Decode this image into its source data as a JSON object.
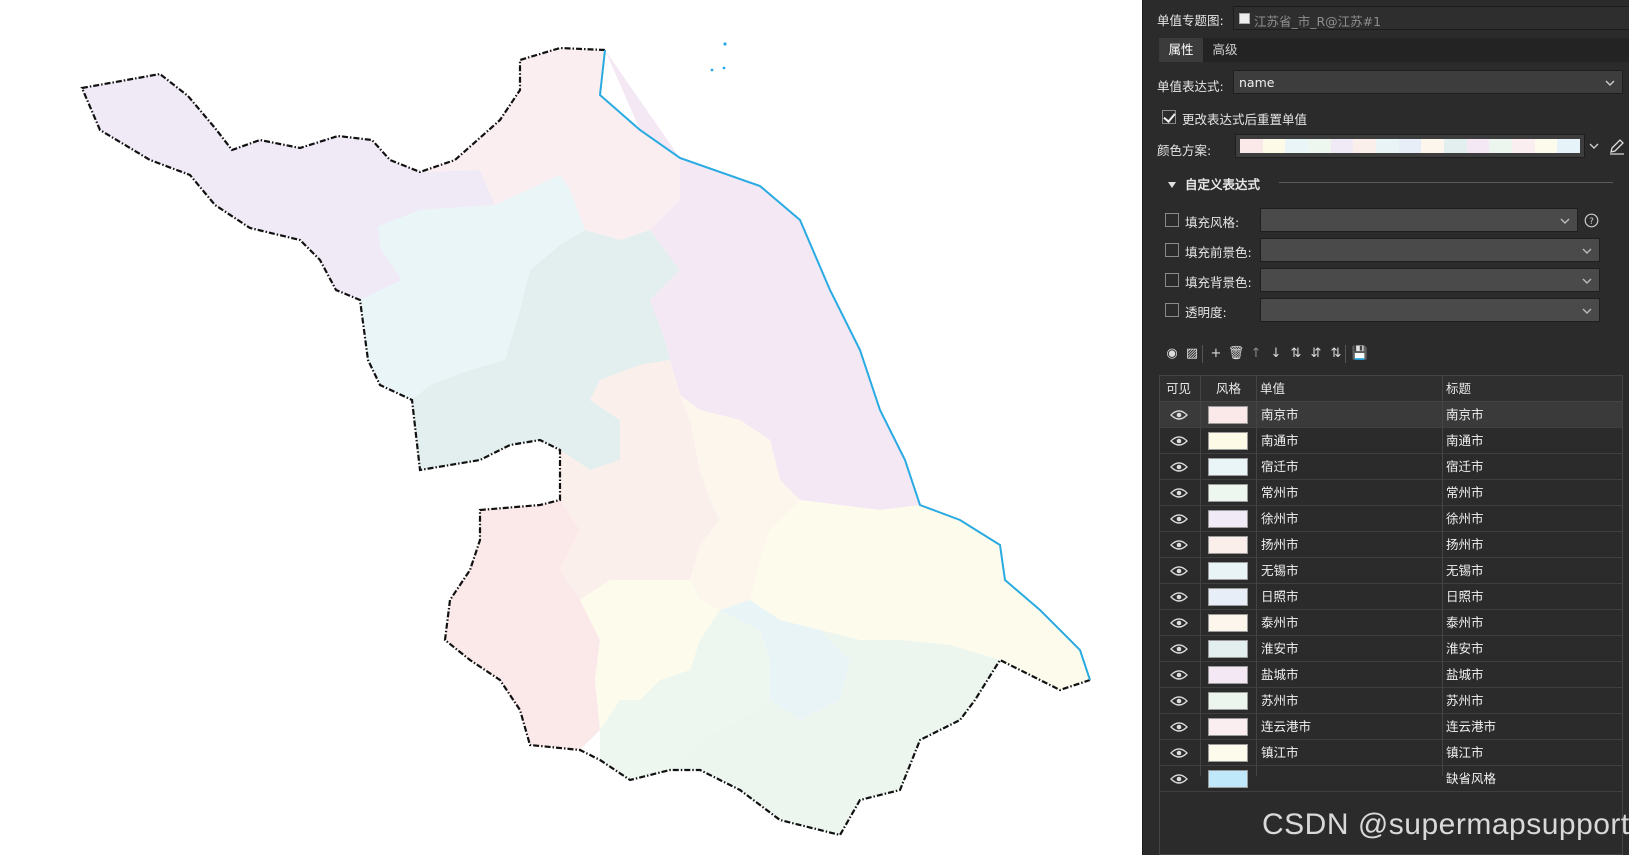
{
  "panel": {
    "thematic_label": "单值专题图:",
    "thematic_value": "江苏省_市_R@江苏#1",
    "tabs": [
      {
        "label": "属性",
        "active": true
      },
      {
        "label": "高级",
        "active": false
      }
    ],
    "expression_label": "单值表达式:",
    "expression_value": "name",
    "reset_checkbox_label": "更改表达式后重置单值",
    "reset_checked": true,
    "color_scheme_label": "颜色方案:",
    "color_scheme": [
      "#fbe9ea",
      "#fdfbe8",
      "#e9f5f7",
      "#eef7ef",
      "#f0e9f6",
      "#fbefec",
      "#e9f4f6",
      "#e8eef8",
      "#fcf6ec",
      "#e2efee",
      "#f4e8f4",
      "#ecf5ee",
      "#faeef0",
      "#fcfbec",
      "#e6f3f8"
    ],
    "custom_expr_section": "自定义表达式",
    "custom_fields": [
      {
        "label": "填充风格:",
        "checked": false,
        "help": true
      },
      {
        "label": "填充前景色:",
        "checked": false,
        "help": false
      },
      {
        "label": "填充背景色:",
        "checked": false,
        "help": false
      },
      {
        "label": "透明度:",
        "checked": false,
        "help": false
      }
    ],
    "toolbar": [
      {
        "name": "visible-toggle-icon",
        "glyph": "◉"
      },
      {
        "name": "style-icon",
        "glyph": "▨"
      },
      {
        "name": "add-icon",
        "glyph": "+"
      },
      {
        "name": "delete-icon",
        "glyph": "🗑"
      },
      {
        "name": "move-up-icon",
        "glyph": "↑"
      },
      {
        "name": "move-down-icon",
        "glyph": "↓"
      },
      {
        "name": "sort-asc-icon",
        "glyph": "⇅"
      },
      {
        "name": "sort-desc-icon",
        "glyph": "⇵"
      },
      {
        "name": "reverse-icon",
        "glyph": "⇅"
      },
      {
        "name": "save-icon",
        "glyph": "💾"
      }
    ],
    "table": {
      "headers": [
        "可见",
        "风格",
        "单值",
        "标题"
      ],
      "rows": [
        {
          "color": "#fbe9ea",
          "value": "南京市",
          "title": "南京市"
        },
        {
          "color": "#fdfbe8",
          "value": "南通市",
          "title": "南通市"
        },
        {
          "color": "#e9f5f7",
          "value": "宿迁市",
          "title": "宿迁市"
        },
        {
          "color": "#eef7ef",
          "value": "常州市",
          "title": "常州市"
        },
        {
          "color": "#f0e9f6",
          "value": "徐州市",
          "title": "徐州市"
        },
        {
          "color": "#fbefec",
          "value": "扬州市",
          "title": "扬州市"
        },
        {
          "color": "#e9f4f6",
          "value": "无锡市",
          "title": "无锡市"
        },
        {
          "color": "#e8eef8",
          "value": "日照市",
          "title": "日照市"
        },
        {
          "color": "#fcf6ec",
          "value": "泰州市",
          "title": "泰州市"
        },
        {
          "color": "#e2efee",
          "value": "淮安市",
          "title": "淮安市"
        },
        {
          "color": "#f4e8f4",
          "value": "盐城市",
          "title": "盐城市"
        },
        {
          "color": "#ecf5ee",
          "value": "苏州市",
          "title": "苏州市"
        },
        {
          "color": "#faeef0",
          "value": "连云港市",
          "title": "连云港市"
        },
        {
          "color": "#fcfbec",
          "value": "镇江市",
          "title": "镇江市"
        },
        {
          "color": "#bfe8fb",
          "value": "",
          "title": "缺省风格"
        }
      ]
    }
  },
  "watermark": "CSDN @supermapsupport",
  "map": {
    "coast_color": "#29abe2",
    "border_color": "#111111"
  }
}
